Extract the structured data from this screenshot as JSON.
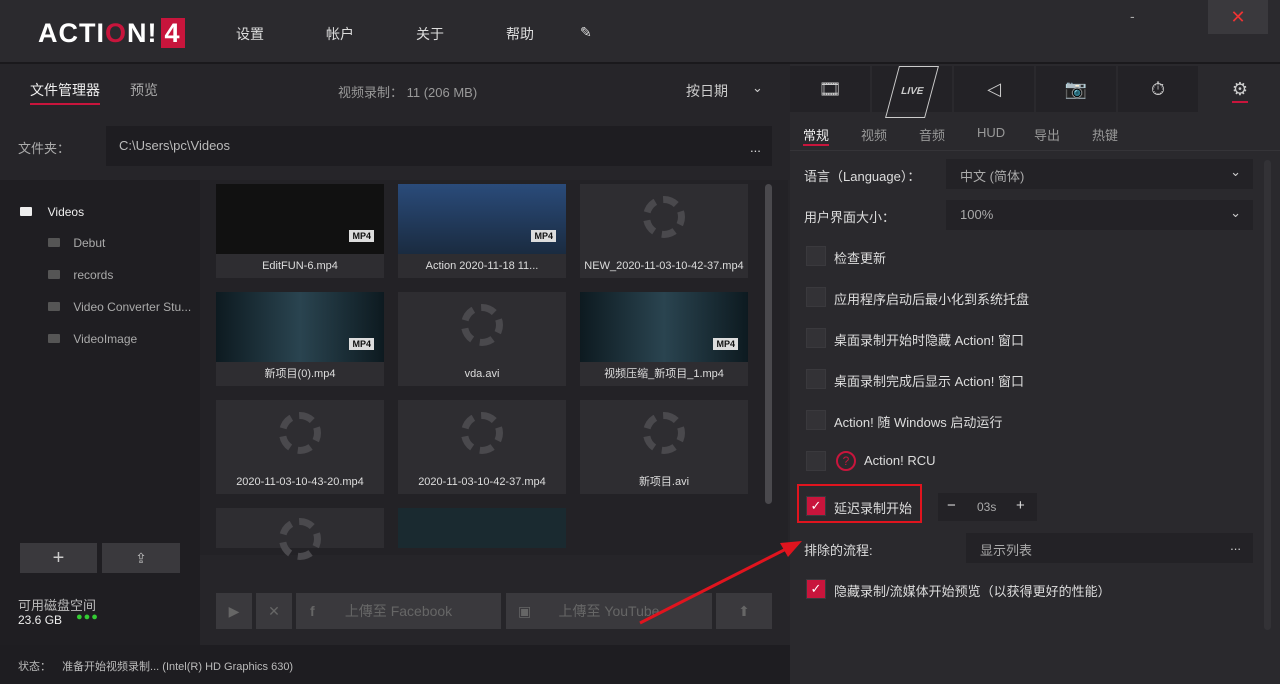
{
  "header": {
    "logo": "ACTION! 4",
    "menu": [
      "设置",
      "帐户",
      "关于",
      "帮助"
    ],
    "minimize": "-",
    "close": "✕"
  },
  "left": {
    "tabs": [
      "文件管理器",
      "预览"
    ],
    "recordings": "视频录制： 11 (206 MB)",
    "sort": "按日期",
    "folder_label": "文件夹：",
    "folder_path": "C:\\Users\\pc\\Videos",
    "folder_more": "...",
    "tree": [
      {
        "label": "Videos"
      },
      {
        "label": "Debut"
      },
      {
        "label": "records"
      },
      {
        "label": "Video Converter Stu..."
      },
      {
        "label": "VideoImage"
      }
    ],
    "disk_label": "可用磁盘空间",
    "disk_value": "23.6 GB",
    "thumbs": [
      {
        "name": "EditFUN-6.mp4",
        "kind": "image"
      },
      {
        "name": "Action 2020-11-18 11...",
        "kind": "screen"
      },
      {
        "name": "NEW_2020-11-03-10-42-37.mp4",
        "kind": "loading"
      },
      {
        "name": "新项目(0).mp4",
        "kind": "joker"
      },
      {
        "name": "vda.avi",
        "kind": "loading"
      },
      {
        "name": "视频压缩_新项目_1.mp4",
        "kind": "joker"
      },
      {
        "name": "2020-11-03-10-43-20.mp4",
        "kind": "loading"
      },
      {
        "name": "2020-11-03-10-42-37.mp4",
        "kind": "loading"
      },
      {
        "name": "新项目.avi",
        "kind": "loading"
      }
    ],
    "mp4_badge": "MP4",
    "upload_facebook": "上傳至 Facebook",
    "upload_youtube": "上傳至 YouTube"
  },
  "status": {
    "label": "状态：",
    "text": "准备开始视频录制... (Intel(R) HD Graphics 630)"
  },
  "right": {
    "icon_tabs": [
      "video",
      "LIVE",
      "audio",
      "camera",
      "timer",
      "settings"
    ],
    "sub_tabs": [
      "常规",
      "视频",
      "音频",
      "HUD",
      "导出",
      "热键"
    ],
    "language_label": "语言（Language）：",
    "language_value": "中文 (简体)",
    "ui_size_label": "用户界面大小：",
    "ui_size_value": "100%",
    "checks": [
      {
        "label": "检查更新",
        "checked": false
      },
      {
        "label": "应用程序启动后最小化到系统托盘",
        "checked": false
      },
      {
        "label": "桌面录制开始时隐藏 Action! 窗口",
        "checked": false
      },
      {
        "label": "桌面录制完成后显示 Action! 窗口",
        "checked": false
      },
      {
        "label": "Action! 随 Windows 启动运行",
        "checked": false
      },
      {
        "label": "Action! RCU",
        "checked": false
      }
    ],
    "delay_label": "延迟录制开始",
    "delay_value": "03s",
    "excluded_label": "排除的流程:",
    "excluded_value": "显示列表",
    "excluded_more": "...",
    "hide_preview_label": "隐藏录制/流媒体开始预览（以获得更好的性能）"
  },
  "colors": {
    "accent": "#c8153c",
    "highlight_box": "#e0141e"
  }
}
